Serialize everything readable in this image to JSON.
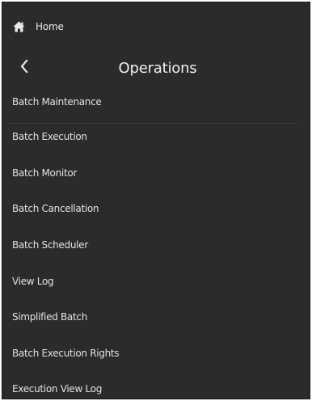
{
  "nav": {
    "home_label": "Home"
  },
  "header": {
    "title": "Operations"
  },
  "menu": {
    "items": [
      {
        "label": "Batch Maintenance"
      },
      {
        "label": "Batch Execution"
      },
      {
        "label": "Batch Monitor"
      },
      {
        "label": "Batch Cancellation"
      },
      {
        "label": "Batch Scheduler"
      },
      {
        "label": "View Log"
      },
      {
        "label": "Simplified Batch"
      },
      {
        "label": "Batch Execution Rights"
      },
      {
        "label": "Execution View Log"
      }
    ]
  },
  "colors": {
    "panel_background": "#2b2b2b",
    "text": "#e2e2e2",
    "divider": "#3d3d3d"
  },
  "icons": {
    "home": "home-icon",
    "back": "chevron-left-icon"
  }
}
